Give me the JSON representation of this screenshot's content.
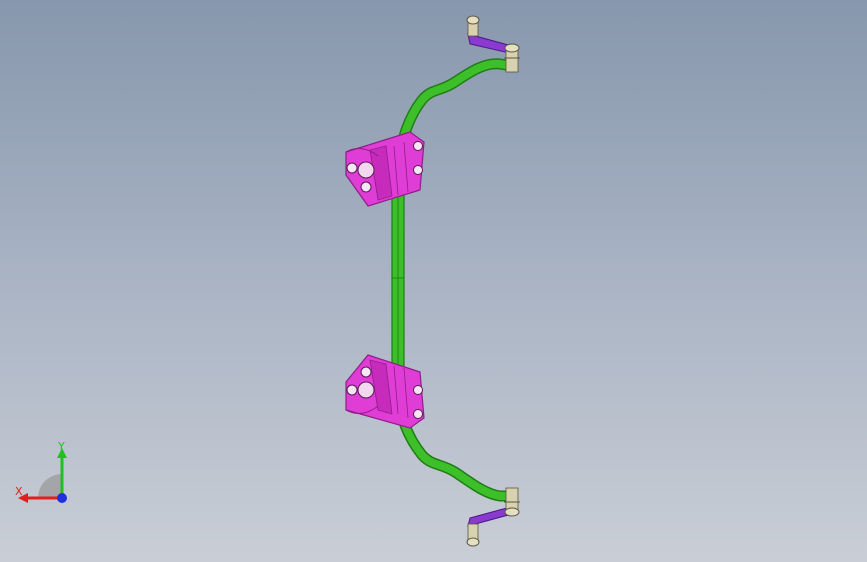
{
  "viewport": {
    "background_top": "#8797ad",
    "background_bottom": "#c9ced6"
  },
  "model": {
    "part": "stabilizer-bar-assembly",
    "colors": {
      "bar": "#3dbf2a",
      "bar_dark": "#1f7d14",
      "bracket": "#e03cd6",
      "bracket_dark": "#8e1f88",
      "link": "#8a3ad0",
      "hardware": "#d8d2b0"
    }
  },
  "triad": {
    "x_label": "X",
    "y_label": "Y",
    "x_color": "#e02020",
    "y_color": "#20c020",
    "z_color": "#2030e0"
  }
}
